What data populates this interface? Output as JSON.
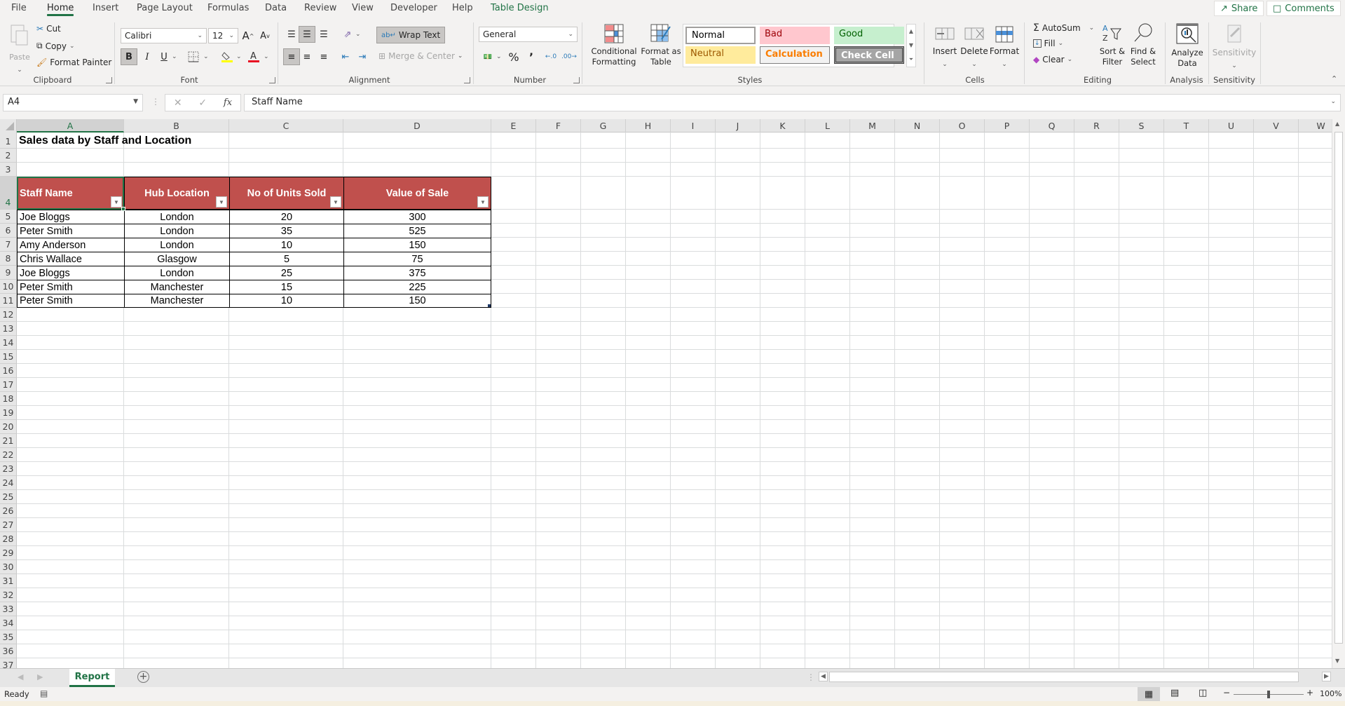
{
  "tabs": [
    "File",
    "Home",
    "Insert",
    "Page Layout",
    "Formulas",
    "Data",
    "Review",
    "View",
    "Developer",
    "Help",
    "Table Design"
  ],
  "active_tab": "Home",
  "top_buttons": {
    "share": "Share",
    "comments": "Comments"
  },
  "clipboard": {
    "paste": "Paste",
    "cut": "Cut",
    "copy": "Copy",
    "format_painter": "Format Painter",
    "label": "Clipboard"
  },
  "font": {
    "name": "Calibri",
    "size": "12",
    "grow": "A",
    "shrink": "A",
    "bold": "B",
    "italic": "I",
    "underline": "U",
    "label": "Font",
    "fill_color": "#ffff00",
    "font_color": "#e81123"
  },
  "alignment": {
    "wrap_text": "Wrap Text",
    "merge_center": "Merge & Center",
    "label": "Alignment"
  },
  "number": {
    "format": "General",
    "percent": "%",
    "comma": "9",
    "label": "Number"
  },
  "styles": {
    "conditional": "Conditional Formatting",
    "format_table": "Format as Table",
    "label": "Styles",
    "cells": [
      {
        "label": "Normal",
        "bg": "#ffffff",
        "fg": "#000000"
      },
      {
        "label": "Bad",
        "bg": "#ffc7ce",
        "fg": "#9c0006"
      },
      {
        "label": "Good",
        "bg": "#c6efce",
        "fg": "#006100"
      },
      {
        "label": "Neutral",
        "bg": "#ffeb9c",
        "fg": "#9c5700"
      },
      {
        "label": "Calculation",
        "bg": "#f2f2f2",
        "fg": "#fa7d00"
      },
      {
        "label": "Check Cell",
        "bg": "#a5a5a5",
        "fg": "#ffffff"
      }
    ]
  },
  "cells_group": {
    "insert": "Insert",
    "delete": "Delete",
    "format": "Format",
    "label": "Cells"
  },
  "editing": {
    "autosum": "AutoSum",
    "fill": "Fill",
    "clear": "Clear",
    "sort": "Sort & Filter",
    "find": "Find & Select",
    "label": "Editing"
  },
  "analysis": {
    "analyze": "Analyze Data",
    "label": "Analysis"
  },
  "sensitivity": {
    "button": "Sensitivity",
    "label": "Sensitivity"
  },
  "formula_bar": {
    "name_box": "A4",
    "formula": "Staff Name",
    "fx": "fx"
  },
  "columns": [
    "A",
    "B",
    "C",
    "D",
    "E",
    "F",
    "G",
    "H",
    "I",
    "J",
    "K",
    "L",
    "M",
    "N",
    "O",
    "P",
    "Q",
    "R",
    "S",
    "T",
    "U",
    "V",
    "W"
  ],
  "selected_column": "A",
  "selected_row": 4,
  "sheet_title": "Sales data by Staff and Location",
  "table": {
    "headers": [
      "Staff Name",
      "Hub Location",
      "No of Units Sold",
      "Value of Sale"
    ],
    "header_color": "#c0504d",
    "rows": [
      [
        "Joe Bloggs",
        "London",
        "20",
        "300"
      ],
      [
        "Peter Smith",
        "London",
        "35",
        "525"
      ],
      [
        "Amy Anderson",
        "London",
        "10",
        "150"
      ],
      [
        "Chris Wallace",
        "Glasgow",
        "5",
        "75"
      ],
      [
        "Joe Bloggs",
        "London",
        "25",
        "375"
      ],
      [
        "Peter Smith",
        "Manchester",
        "15",
        "225"
      ],
      [
        "Peter Smith",
        "Manchester",
        "10",
        "150"
      ]
    ]
  },
  "sheets": [
    {
      "name": "Report",
      "active": true
    }
  ],
  "status": {
    "ready": "Ready",
    "zoom": "100%"
  }
}
